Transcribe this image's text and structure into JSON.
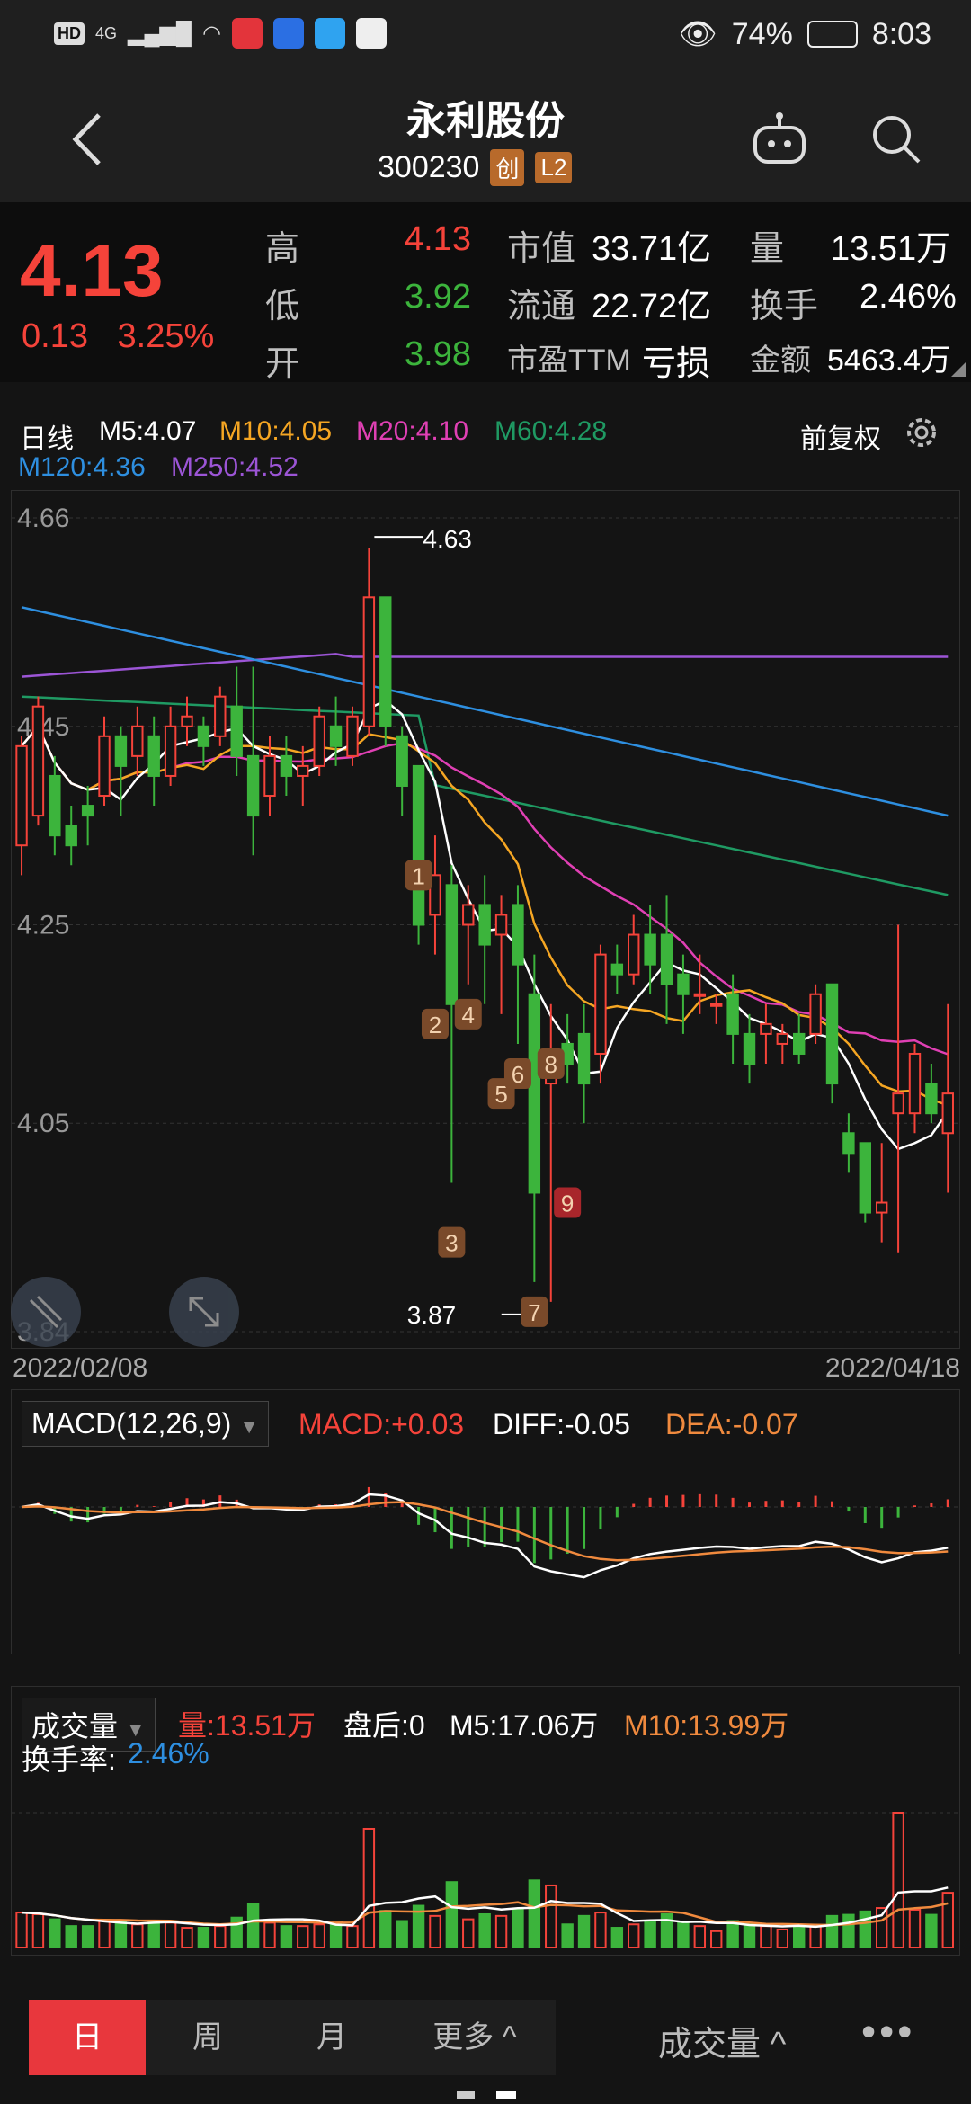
{
  "status": {
    "net_left": "HD",
    "net_4g": "4G",
    "battery": "74%",
    "time": "8:03"
  },
  "header": {
    "stock_name": "永利股份",
    "code": "300230",
    "tag1": "创",
    "tag2": "L2"
  },
  "quote": {
    "price": "4.13",
    "change": "0.13",
    "change_pct": "3.25%",
    "high_label": "高",
    "high": "4.13",
    "low_label": "低",
    "low": "3.92",
    "open_label": "开",
    "open": "3.98",
    "mcap_label": "市值",
    "mcap": "33.71亿",
    "float_label": "流通",
    "float": "22.72亿",
    "pe_label": "市盈TTM",
    "pe": "亏损",
    "vol_label": "量",
    "vol": "13.51万",
    "turn_label": "换手",
    "turn": "2.46%",
    "amt_label": "金额",
    "amt": "5463.4万"
  },
  "ma_legend": {
    "period": "日线",
    "m5": "M5:4.07",
    "m10": "M10:4.05",
    "m20": "M20:4.10",
    "m60": "M60:4.28",
    "m120": "M120:4.36",
    "m250": "M250:4.52",
    "adjust": "前复权"
  },
  "colors": {
    "up": "#f5433a",
    "down": "#3cb43c",
    "m5": "#ffffff",
    "m10": "#f5a623",
    "m20": "#e040b4",
    "m60": "#1f9a63",
    "m120": "#2e8fe0",
    "m250": "#9c55d6"
  },
  "chart": {
    "y_ticks": [
      "4.66",
      "4.45",
      "4.25",
      "4.05",
      "3.84"
    ],
    "high_mark": "4.63",
    "low_mark": "3.87",
    "start_date": "2022/02/08",
    "end_date": "2022/04/18",
    "tags": [
      "1",
      "2",
      "3",
      "4",
      "5",
      "6",
      "7",
      "8",
      "9"
    ]
  },
  "chart_data": {
    "type": "candlestick",
    "x_range": [
      "2022/02/08",
      "2022/04/18"
    ],
    "ylim": [
      3.84,
      4.66
    ],
    "candles": [
      [
        4.33,
        4.43,
        4.3,
        4.44
      ],
      [
        4.36,
        4.47,
        4.35,
        4.48
      ],
      [
        4.4,
        4.34,
        4.32,
        4.42
      ],
      [
        4.35,
        4.33,
        4.31,
        4.37
      ],
      [
        4.37,
        4.36,
        4.33,
        4.39
      ],
      [
        4.38,
        4.44,
        4.37,
        4.46
      ],
      [
        4.44,
        4.41,
        4.36,
        4.45
      ],
      [
        4.42,
        4.45,
        4.4,
        4.47
      ],
      [
        4.44,
        4.4,
        4.37,
        4.46
      ],
      [
        4.4,
        4.45,
        4.39,
        4.47
      ],
      [
        4.45,
        4.46,
        4.43,
        4.48
      ],
      [
        4.45,
        4.43,
        4.41,
        4.46
      ],
      [
        4.44,
        4.48,
        4.43,
        4.49
      ],
      [
        4.47,
        4.42,
        4.4,
        4.51
      ],
      [
        4.42,
        4.36,
        4.32,
        4.51
      ],
      [
        4.38,
        4.42,
        4.36,
        4.44
      ],
      [
        4.42,
        4.4,
        4.38,
        4.44
      ],
      [
        4.4,
        4.41,
        4.37,
        4.43
      ],
      [
        4.41,
        4.46,
        4.4,
        4.47
      ],
      [
        4.45,
        4.43,
        4.41,
        4.48
      ],
      [
        4.42,
        4.46,
        4.41,
        4.47
      ],
      [
        4.45,
        4.58,
        4.44,
        4.63
      ],
      [
        4.58,
        4.45,
        4.43,
        4.58
      ],
      [
        4.44,
        4.39,
        4.36,
        4.45
      ],
      [
        4.41,
        4.25,
        4.23,
        4.41
      ],
      [
        4.26,
        4.3,
        4.22,
        4.34
      ],
      [
        4.29,
        4.17,
        3.99,
        4.31
      ],
      [
        4.25,
        4.27,
        4.19,
        4.29
      ],
      [
        4.27,
        4.23,
        4.17,
        4.3
      ],
      [
        4.24,
        4.26,
        4.16,
        4.28
      ],
      [
        4.27,
        4.21,
        4.13,
        4.29
      ],
      [
        4.18,
        3.98,
        3.89,
        4.22
      ],
      [
        4.09,
        4.11,
        3.87,
        4.17
      ],
      [
        4.13,
        4.11,
        4.09,
        4.16
      ],
      [
        4.14,
        4.09,
        4.05,
        4.17
      ],
      [
        4.12,
        4.22,
        4.09,
        4.23
      ],
      [
        4.21,
        4.2,
        4.18,
        4.23
      ],
      [
        4.2,
        4.24,
        4.19,
        4.26
      ],
      [
        4.24,
        4.21,
        4.18,
        4.27
      ],
      [
        4.24,
        4.19,
        4.15,
        4.28
      ],
      [
        4.2,
        4.18,
        4.14,
        4.22
      ],
      [
        4.18,
        4.18,
        4.16,
        4.22
      ],
      [
        4.17,
        4.17,
        4.15,
        4.18
      ],
      [
        4.18,
        4.14,
        4.11,
        4.2
      ],
      [
        4.14,
        4.11,
        4.09,
        4.16
      ],
      [
        4.14,
        4.15,
        4.11,
        4.17
      ],
      [
        4.13,
        4.14,
        4.11,
        4.15
      ],
      [
        4.14,
        4.12,
        4.11,
        4.16
      ],
      [
        4.14,
        4.18,
        4.13,
        4.19
      ],
      [
        4.19,
        4.09,
        4.07,
        4.19
      ],
      [
        4.04,
        4.02,
        4.0,
        4.06
      ],
      [
        4.03,
        3.96,
        3.95,
        4.03
      ],
      [
        3.96,
        3.97,
        3.93,
        4.03
      ],
      [
        4.06,
        4.08,
        3.92,
        4.25
      ],
      [
        4.06,
        4.12,
        4.04,
        4.13
      ],
      [
        4.09,
        4.06,
        4.05,
        4.11
      ],
      [
        4.04,
        4.08,
        3.98,
        4.17
      ]
    ],
    "ma_last": {
      "M5": 4.07,
      "M10": 4.05,
      "M20": 4.1,
      "M60": 4.28,
      "M120": 4.36,
      "M250": 4.52
    }
  },
  "macd": {
    "selector": "MACD(12,26,9)",
    "macd": "MACD:+0.03",
    "diff": "DIFF:-0.05",
    "dea": "DEA:-0.07"
  },
  "volume": {
    "selector": "成交量",
    "vol": "量:13.51万",
    "after": "盘后:0",
    "m5": "M5:17.06万",
    "m10": "M10:13.99万",
    "turn_label": "换手率:",
    "turn": "2.46%"
  },
  "bottom": {
    "tab_day": "日",
    "tab_week": "周",
    "tab_month": "月",
    "tab_more": "更多 ^",
    "indicator": "成交量 ^",
    "menu": "•••"
  }
}
